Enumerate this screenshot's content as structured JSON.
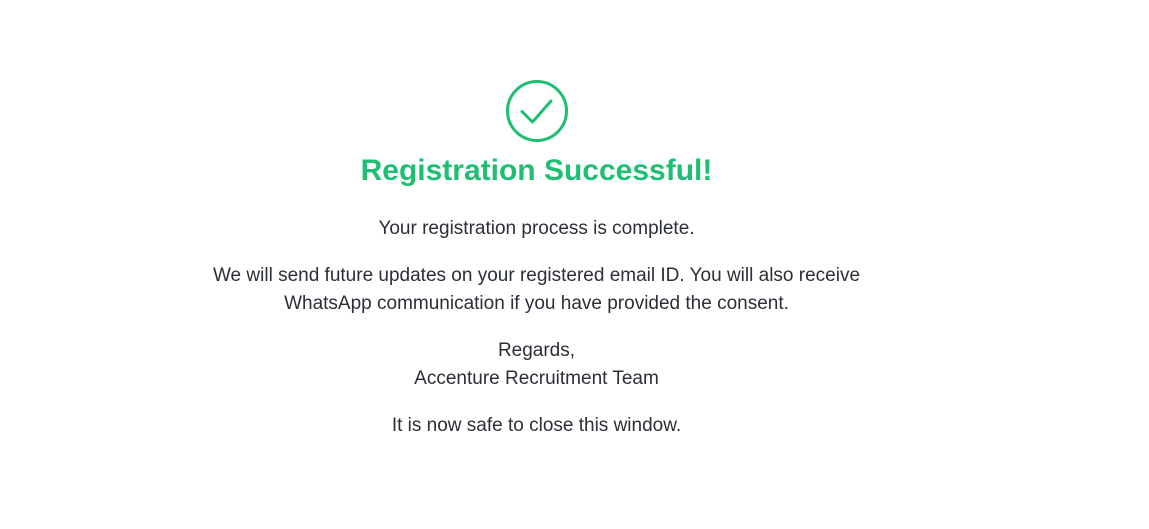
{
  "success": {
    "icon": "check-circle-icon",
    "accent_color": "#1ebf73",
    "title": "Registration Successful!",
    "status_message": "Your registration process is complete.",
    "updates_line1": "We will send future updates on your registered email ID. You will also receive",
    "updates_line2": "WhatsApp communication if you have provided the consent.",
    "regards": "Regards,",
    "signature": "Accenture Recruitment Team",
    "close_message": "It is now safe to close this window."
  }
}
